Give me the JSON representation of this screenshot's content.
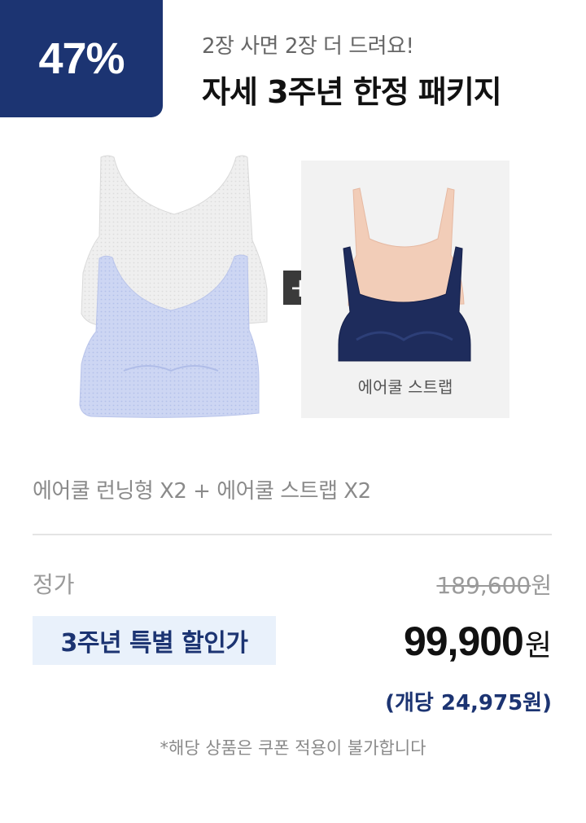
{
  "badge": {
    "discount": "47%",
    "color": "#1c3472"
  },
  "header": {
    "subtitle": "2장 사면 2장 더 드려요!",
    "title": "자세 3주년 한정 패키지"
  },
  "images": {
    "left_product": {
      "colors": [
        "#ededed",
        "#c9d3f2"
      ]
    },
    "plus_icon": "+",
    "strap_product": {
      "caption": "에어쿨 스트랩",
      "colors": [
        "#f2cdb8",
        "#1e2c5c"
      ]
    }
  },
  "composition": "에어쿨 런닝형 X2 + 에어쿨 스트랩 X2",
  "pricing": {
    "regular_label": "정가",
    "regular_price": "189,600",
    "regular_unit": "원",
    "sale_label": "3주년 특별 할인가",
    "sale_price": "99,900",
    "sale_unit": "원",
    "per_unit": "(개당 24,975원)"
  },
  "notice": "*해당 상품은 쿠폰 적용이 불가합니다"
}
